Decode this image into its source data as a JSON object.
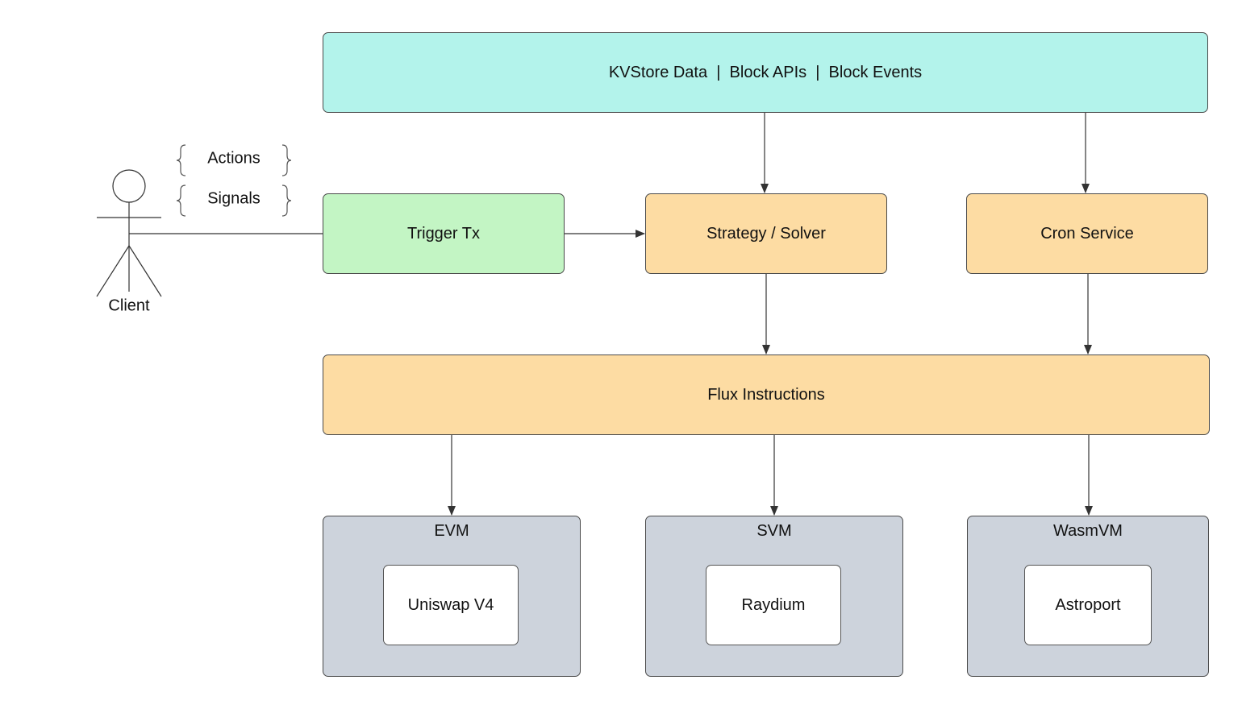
{
  "colors": {
    "data_layer": "#b3f3eb",
    "trigger": "#c3f5c4",
    "process": "#fddca3",
    "vm": "#cdd3dc",
    "stroke": "#333333"
  },
  "data_layer": {
    "label": "KVStore Data  |  Block APIs  |  Block Events"
  },
  "client": {
    "label": "Client",
    "inputs": [
      "Actions",
      "Signals"
    ]
  },
  "trigger": {
    "label": "Trigger Tx"
  },
  "strategy": {
    "label": "Strategy / Solver"
  },
  "cron": {
    "label": "Cron Service"
  },
  "flux": {
    "label": "Flux Instructions"
  },
  "vms": [
    {
      "label": "EVM",
      "app": "Uniswap V4"
    },
    {
      "label": "SVM",
      "app": "Raydium"
    },
    {
      "label": "WasmVM",
      "app": "Astroport"
    }
  ]
}
